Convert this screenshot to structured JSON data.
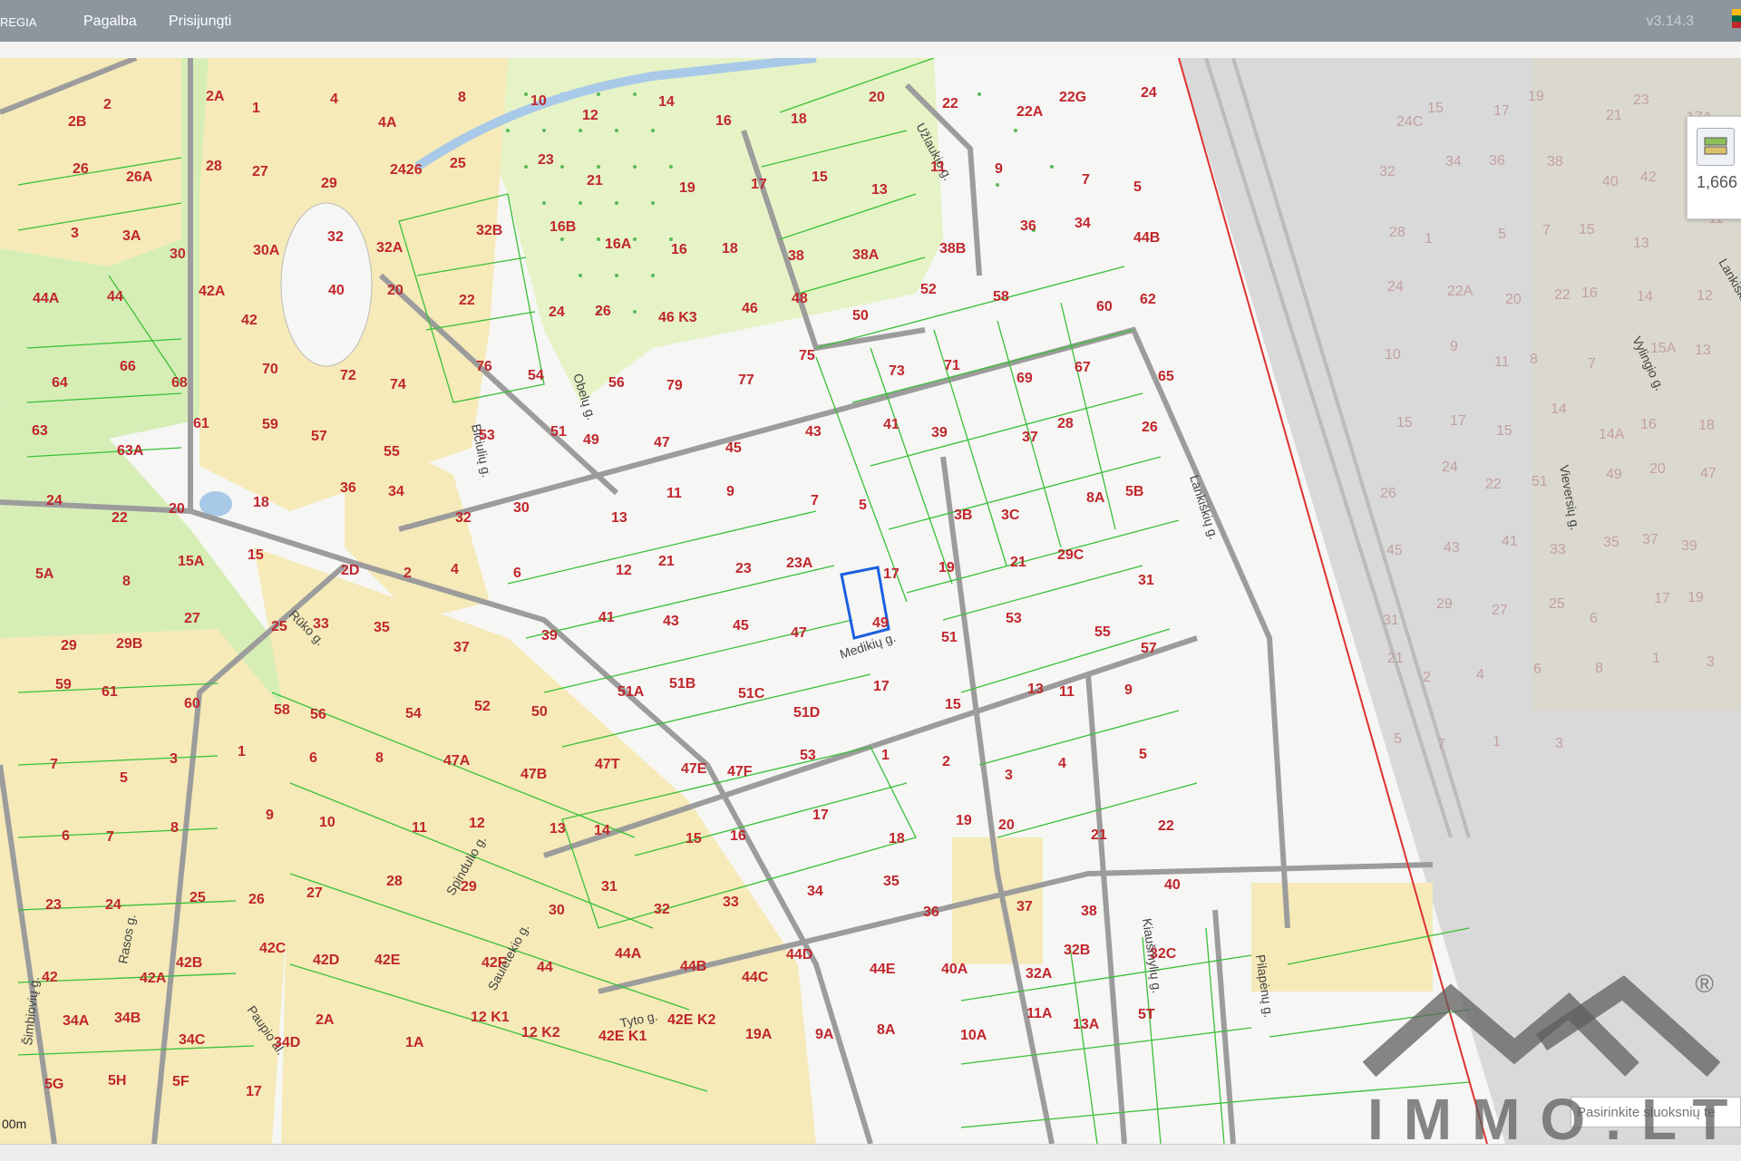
{
  "header": {
    "app_name_fragment": "REGIA",
    "nav": [
      "Pagalba",
      "Prisijungti"
    ],
    "version": "v3.14.3"
  },
  "map": {
    "streets": [
      "Obelų g.",
      "Užlaukio g.",
      "Bičiulių g.",
      "Rūko g.",
      "Medikių g.",
      "Lankiškių g.",
      "Spindulio g.",
      "Saulėtekio g.",
      "Rasos g.",
      "Šimbiovių g.",
      "Paupio al.",
      "Kiaušmylių g.",
      "Pilapėnų g.",
      "Vylingio g.",
      "Vieversių g.",
      "Tyto g.",
      "Lankiškių g."
    ],
    "parcel_labels": [
      "2B",
      "2",
      "2A",
      "1",
      "4",
      "4A",
      "8",
      "10",
      "12",
      "14",
      "16",
      "18",
      "20",
      "22",
      "22A",
      "22G",
      "24",
      "26",
      "26A",
      "28",
      "27",
      "29",
      "2426",
      "25",
      "23",
      "21",
      "19",
      "17",
      "15",
      "13",
      "11",
      "9",
      "7",
      "5",
      "3",
      "3A",
      "30",
      "30A",
      "32",
      "32A",
      "32B",
      "16B",
      "16A",
      "16",
      "18",
      "38",
      "38A",
      "38B",
      "36",
      "34",
      "44B",
      "44A",
      "44",
      "42A",
      "42",
      "40",
      "20",
      "22",
      "24",
      "26",
      "46 K3",
      "46",
      "48",
      "50",
      "52",
      "58",
      "60",
      "62",
      "64",
      "66",
      "68",
      "70",
      "72",
      "74",
      "76",
      "54",
      "56",
      "79",
      "77",
      "75",
      "73",
      "71",
      "69",
      "67",
      "65",
      "63",
      "63A",
      "61",
      "59",
      "57",
      "55",
      "53",
      "51",
      "49",
      "47",
      "45",
      "43",
      "41",
      "39",
      "37",
      "28",
      "26",
      "24",
      "22",
      "20",
      "18",
      "36",
      "34",
      "32",
      "30",
      "13",
      "11",
      "9",
      "7",
      "5",
      "3B",
      "3C",
      "8A",
      "5B",
      "5A",
      "8",
      "15A",
      "15",
      "2D",
      "2",
      "4",
      "6",
      "12",
      "21",
      "23",
      "23A",
      "17",
      "19",
      "21",
      "29C",
      "31",
      "29",
      "29B",
      "27",
      "25",
      "33",
      "35",
      "37",
      "39",
      "41",
      "43",
      "45",
      "47",
      "49",
      "51",
      "53",
      "55",
      "57",
      "59",
      "61",
      "60",
      "58",
      "56",
      "54",
      "52",
      "50",
      "51A",
      "51B",
      "51C",
      "51D",
      "17",
      "15",
      "13",
      "11",
      "9",
      "7",
      "5",
      "3",
      "1",
      "6",
      "8",
      "47A",
      "47B",
      "47T",
      "47E",
      "47F",
      "53",
      "1",
      "2",
      "3",
      "4",
      "5",
      "6",
      "7",
      "8",
      "9",
      "10",
      "11",
      "12",
      "13",
      "14",
      "15",
      "16",
      "17",
      "18",
      "19",
      "20",
      "21",
      "22",
      "23",
      "24",
      "25",
      "26",
      "27",
      "28",
      "29",
      "30",
      "31",
      "32",
      "33",
      "34",
      "35",
      "36",
      "37",
      "38",
      "40",
      "42",
      "42A",
      "42B",
      "42C",
      "42D",
      "42E",
      "42F",
      "44",
      "44A",
      "44B",
      "44C",
      "44D",
      "44E",
      "40A",
      "32A",
      "32B",
      "32C",
      "34A",
      "34B",
      "34C",
      "34D",
      "2A",
      "1A",
      "12 K1",
      "12 K2",
      "42E K1",
      "42E K2",
      "19A",
      "9A",
      "8A",
      "10A",
      "11A",
      "13A",
      "5T",
      "5G",
      "5H",
      "5F",
      "17"
    ],
    "east_parcel_labels": [
      "24C",
      "15",
      "17",
      "19",
      "21",
      "23",
      "17A",
      "32",
      "34",
      "36",
      "38",
      "40",
      "42",
      "26",
      "28",
      "1",
      "5",
      "7",
      "15",
      "13",
      "11",
      "24",
      "22A",
      "20",
      "22",
      "16",
      "14",
      "12",
      "10",
      "9",
      "11",
      "8",
      "7",
      "15A",
      "13",
      "15",
      "17",
      "15",
      "14",
      "14A",
      "16",
      "18",
      "26",
      "24",
      "22",
      "51",
      "49",
      "20",
      "47",
      "45",
      "43",
      "41",
      "33",
      "35",
      "37",
      "39",
      "31",
      "29",
      "27",
      "25",
      "6",
      "17",
      "19",
      "21",
      "2",
      "4",
      "6",
      "8",
      "1",
      "3",
      "5",
      "7",
      "1",
      "3"
    ],
    "scale_label": "00m",
    "boundary_color": "#e03030",
    "parcel_line_color": "#38c038",
    "selected_parcel_color": "#1a5fe0",
    "residential_fill": "#f5eab8",
    "green_fill": "#d6eeb6",
    "road_color": "#9c9c9c"
  },
  "layer_panel": {
    "value": "1,666",
    "search_placeholder": "Pasirinkite sluoksnių te"
  },
  "watermark": {
    "text": "IMMO.LT",
    "registered": "®"
  }
}
